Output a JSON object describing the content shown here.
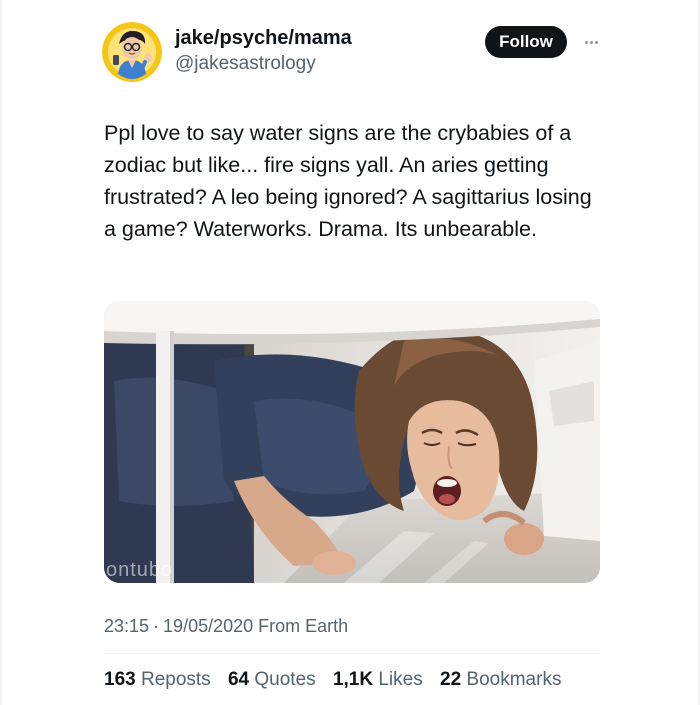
{
  "tweet": {
    "author": {
      "display_name": "jake/psyche/mama",
      "handle": "@jakesastrology",
      "avatar_icon": "cartoon-avatar-icon"
    },
    "follow_label": "Follow",
    "more_icon": "more-dots-icon",
    "text": "Ppl love to say water signs are the crybabies of a zodiac but like... fire signs yall. An aries getting frustrated? A leo being ignored? A sagittarius losing a game? Waterworks. Drama. Its unbearable.",
    "media": {
      "watermark": "ontubo"
    },
    "time": "23:15",
    "separator": "·",
    "date": "19/05/2020",
    "location": "From Earth",
    "stats": {
      "reposts_count": "163",
      "reposts_label": "Reposts",
      "quotes_count": "64",
      "quotes_label": "Quotes",
      "likes_count": "1,1K",
      "likes_label": "Likes",
      "bookmarks_count": "22",
      "bookmarks_label": "Bookmarks"
    }
  },
  "colors": {
    "text_primary": "#0f1419",
    "text_secondary": "#536471",
    "button_bg": "#0f1419",
    "avatar_ring": "#f5c518"
  }
}
